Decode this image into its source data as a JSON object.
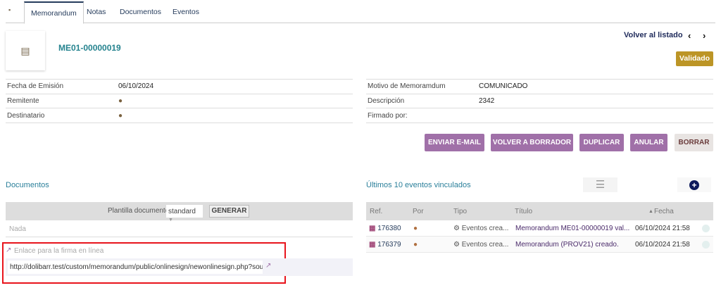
{
  "tabs": [
    "Memorandum",
    "Notas",
    "Documentos",
    "Eventos"
  ],
  "header": {
    "ref": "ME01-00000019",
    "back_label": "Volver al listado",
    "prev": "‹",
    "next": "›",
    "status": "Validado"
  },
  "left_fields": [
    {
      "label": "Fecha de Emisión",
      "value": "06/10/2024"
    },
    {
      "label": "Remitente",
      "value": ""
    },
    {
      "label": "Destinatario",
      "value": ""
    }
  ],
  "right_fields": [
    {
      "label": "Motivo de Memoramdum",
      "value": "COMUNICADO"
    },
    {
      "label": "Descripción",
      "value": "2342"
    },
    {
      "label": "Firmado por:",
      "value": ""
    }
  ],
  "actions": [
    "ENVIAR E-MAIL",
    "VOLVER A BORRADOR",
    "DUPLICAR",
    "ANULAR",
    "BORRAR"
  ],
  "documents": {
    "title": "Documentos",
    "template_label": "Plantilla documento",
    "template_value": "standard",
    "generate": "GENERAR",
    "empty": "Nada",
    "sign_label": "Enlace para la firma en línea",
    "sign_url": "http://dolibarr.test/custom/memorandum/public/onlinesign/newonlinesign.php?source=n"
  },
  "events": {
    "title": "Últimos 10 eventos vinculados",
    "columns": [
      "Ref.",
      "Por",
      "Tipo",
      "Título",
      "Fecha"
    ],
    "rows": [
      {
        "ref": "176380",
        "type": "Eventos crea...",
        "title": "Memorandum ME01-00000019 val...",
        "date": "06/10/2024 21:58"
      },
      {
        "ref": "176379",
        "type": "Eventos crea...",
        "title": "Memorandum (PROV21) creado.",
        "date": "06/10/2024 21:58"
      }
    ]
  },
  "colors": {
    "accent": "#25838f",
    "button": "#a070a8",
    "status": "#bc9526",
    "highlight": "#e8141c"
  }
}
